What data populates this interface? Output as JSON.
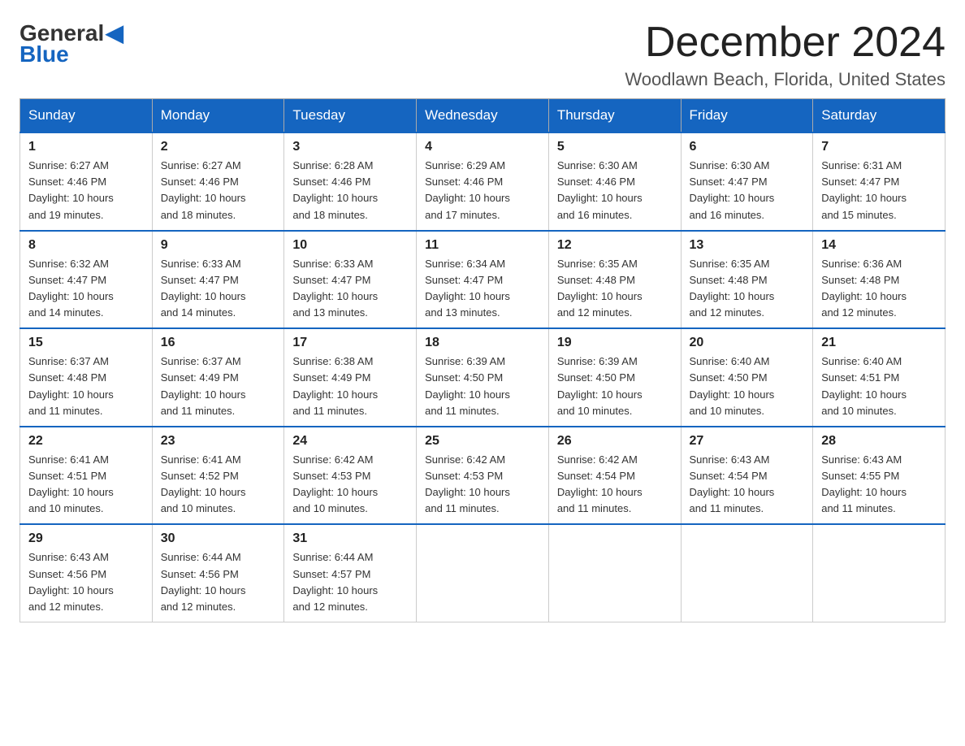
{
  "logo": {
    "general": "General",
    "blue": "Blue"
  },
  "header": {
    "month_year": "December 2024",
    "location": "Woodlawn Beach, Florida, United States"
  },
  "weekdays": [
    "Sunday",
    "Monday",
    "Tuesday",
    "Wednesday",
    "Thursday",
    "Friday",
    "Saturday"
  ],
  "weeks": [
    [
      {
        "day": "1",
        "sunrise": "6:27 AM",
        "sunset": "4:46 PM",
        "daylight": "10 hours and 19 minutes."
      },
      {
        "day": "2",
        "sunrise": "6:27 AM",
        "sunset": "4:46 PM",
        "daylight": "10 hours and 18 minutes."
      },
      {
        "day": "3",
        "sunrise": "6:28 AM",
        "sunset": "4:46 PM",
        "daylight": "10 hours and 18 minutes."
      },
      {
        "day": "4",
        "sunrise": "6:29 AM",
        "sunset": "4:46 PM",
        "daylight": "10 hours and 17 minutes."
      },
      {
        "day": "5",
        "sunrise": "6:30 AM",
        "sunset": "4:46 PM",
        "daylight": "10 hours and 16 minutes."
      },
      {
        "day": "6",
        "sunrise": "6:30 AM",
        "sunset": "4:47 PM",
        "daylight": "10 hours and 16 minutes."
      },
      {
        "day": "7",
        "sunrise": "6:31 AM",
        "sunset": "4:47 PM",
        "daylight": "10 hours and 15 minutes."
      }
    ],
    [
      {
        "day": "8",
        "sunrise": "6:32 AM",
        "sunset": "4:47 PM",
        "daylight": "10 hours and 14 minutes."
      },
      {
        "day": "9",
        "sunrise": "6:33 AM",
        "sunset": "4:47 PM",
        "daylight": "10 hours and 14 minutes."
      },
      {
        "day": "10",
        "sunrise": "6:33 AM",
        "sunset": "4:47 PM",
        "daylight": "10 hours and 13 minutes."
      },
      {
        "day": "11",
        "sunrise": "6:34 AM",
        "sunset": "4:47 PM",
        "daylight": "10 hours and 13 minutes."
      },
      {
        "day": "12",
        "sunrise": "6:35 AM",
        "sunset": "4:48 PM",
        "daylight": "10 hours and 12 minutes."
      },
      {
        "day": "13",
        "sunrise": "6:35 AM",
        "sunset": "4:48 PM",
        "daylight": "10 hours and 12 minutes."
      },
      {
        "day": "14",
        "sunrise": "6:36 AM",
        "sunset": "4:48 PM",
        "daylight": "10 hours and 12 minutes."
      }
    ],
    [
      {
        "day": "15",
        "sunrise": "6:37 AM",
        "sunset": "4:48 PM",
        "daylight": "10 hours and 11 minutes."
      },
      {
        "day": "16",
        "sunrise": "6:37 AM",
        "sunset": "4:49 PM",
        "daylight": "10 hours and 11 minutes."
      },
      {
        "day": "17",
        "sunrise": "6:38 AM",
        "sunset": "4:49 PM",
        "daylight": "10 hours and 11 minutes."
      },
      {
        "day": "18",
        "sunrise": "6:39 AM",
        "sunset": "4:50 PM",
        "daylight": "10 hours and 11 minutes."
      },
      {
        "day": "19",
        "sunrise": "6:39 AM",
        "sunset": "4:50 PM",
        "daylight": "10 hours and 10 minutes."
      },
      {
        "day": "20",
        "sunrise": "6:40 AM",
        "sunset": "4:50 PM",
        "daylight": "10 hours and 10 minutes."
      },
      {
        "day": "21",
        "sunrise": "6:40 AM",
        "sunset": "4:51 PM",
        "daylight": "10 hours and 10 minutes."
      }
    ],
    [
      {
        "day": "22",
        "sunrise": "6:41 AM",
        "sunset": "4:51 PM",
        "daylight": "10 hours and 10 minutes."
      },
      {
        "day": "23",
        "sunrise": "6:41 AM",
        "sunset": "4:52 PM",
        "daylight": "10 hours and 10 minutes."
      },
      {
        "day": "24",
        "sunrise": "6:42 AM",
        "sunset": "4:53 PM",
        "daylight": "10 hours and 10 minutes."
      },
      {
        "day": "25",
        "sunrise": "6:42 AM",
        "sunset": "4:53 PM",
        "daylight": "10 hours and 11 minutes."
      },
      {
        "day": "26",
        "sunrise": "6:42 AM",
        "sunset": "4:54 PM",
        "daylight": "10 hours and 11 minutes."
      },
      {
        "day": "27",
        "sunrise": "6:43 AM",
        "sunset": "4:54 PM",
        "daylight": "10 hours and 11 minutes."
      },
      {
        "day": "28",
        "sunrise": "6:43 AM",
        "sunset": "4:55 PM",
        "daylight": "10 hours and 11 minutes."
      }
    ],
    [
      {
        "day": "29",
        "sunrise": "6:43 AM",
        "sunset": "4:56 PM",
        "daylight": "10 hours and 12 minutes."
      },
      {
        "day": "30",
        "sunrise": "6:44 AM",
        "sunset": "4:56 PM",
        "daylight": "10 hours and 12 minutes."
      },
      {
        "day": "31",
        "sunrise": "6:44 AM",
        "sunset": "4:57 PM",
        "daylight": "10 hours and 12 minutes."
      },
      null,
      null,
      null,
      null
    ]
  ],
  "labels": {
    "sunrise": "Sunrise:",
    "sunset": "Sunset:",
    "daylight": "Daylight:"
  }
}
